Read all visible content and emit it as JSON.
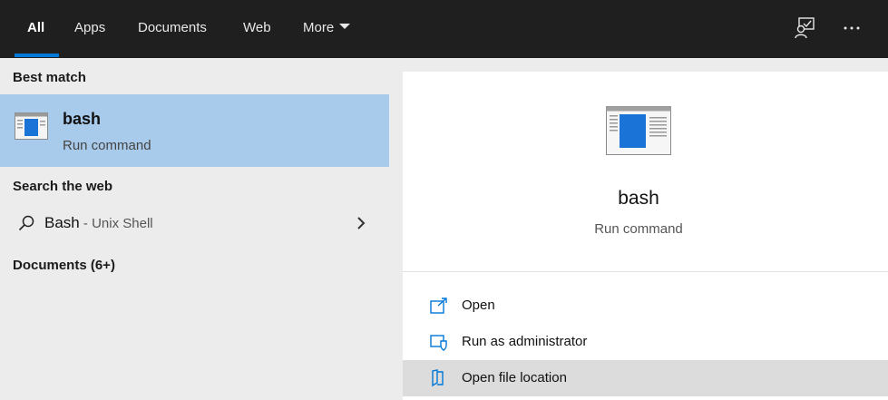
{
  "tabs": [
    {
      "label": "All"
    },
    {
      "label": "Apps"
    },
    {
      "label": "Documents"
    },
    {
      "label": "Web"
    },
    {
      "label": "More"
    }
  ],
  "topbar_icons": [
    "feedback-icon",
    "more-options-icon"
  ],
  "left": {
    "best_match_header": "Best match",
    "best_match": {
      "title": "bash",
      "subtitle": "Run command"
    },
    "search_web_header": "Search the web",
    "web_result": {
      "query": "Bash",
      "suffix": " - Unix Shell"
    },
    "documents_header": "Documents (6+)"
  },
  "preview": {
    "title": "bash",
    "subtitle": "Run command",
    "actions": [
      {
        "label": "Open",
        "icon": "open-icon"
      },
      {
        "label": "Run as administrator",
        "icon": "shield-icon"
      },
      {
        "label": "Open file location",
        "icon": "folder-location-icon"
      }
    ]
  },
  "colors": {
    "accent": "#0078d7",
    "selected": "#a9cbeb",
    "topbar": "#1f1f1f"
  }
}
